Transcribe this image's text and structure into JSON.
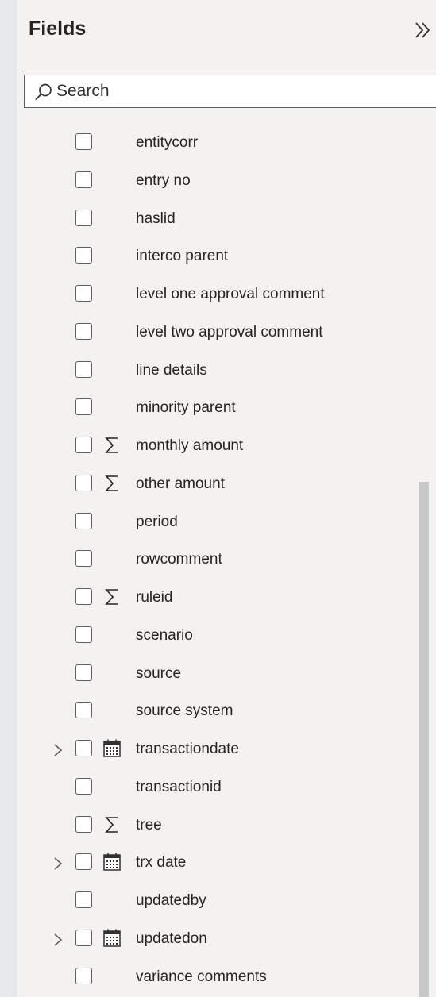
{
  "header": {
    "title": "Fields",
    "collapse_icon": "double-chevron-right-icon"
  },
  "search": {
    "placeholder": "Search",
    "value": ""
  },
  "fields": [
    {
      "label": "entitycorr",
      "type": "text",
      "expandable": false
    },
    {
      "label": "entry no",
      "type": "text",
      "expandable": false
    },
    {
      "label": "haslid",
      "type": "text",
      "expandable": false
    },
    {
      "label": "interco parent",
      "type": "text",
      "expandable": false
    },
    {
      "label": "level one approval comment",
      "type": "text",
      "expandable": false
    },
    {
      "label": "level two approval comment",
      "type": "text",
      "expandable": false
    },
    {
      "label": "line details",
      "type": "text",
      "expandable": false
    },
    {
      "label": "minority parent",
      "type": "text",
      "expandable": false
    },
    {
      "label": "monthly amount",
      "type": "sum",
      "expandable": false
    },
    {
      "label": "other amount",
      "type": "sum",
      "expandable": false
    },
    {
      "label": "period",
      "type": "text",
      "expandable": false
    },
    {
      "label": "rowcomment",
      "type": "text",
      "expandable": false
    },
    {
      "label": "ruleid",
      "type": "sum",
      "expandable": false
    },
    {
      "label": "scenario",
      "type": "text",
      "expandable": false
    },
    {
      "label": "source",
      "type": "text",
      "expandable": false
    },
    {
      "label": "source system",
      "type": "text",
      "expandable": false
    },
    {
      "label": "transactiondate",
      "type": "date",
      "expandable": true
    },
    {
      "label": "transactionid",
      "type": "text",
      "expandable": false
    },
    {
      "label": "tree",
      "type": "sum",
      "expandable": false
    },
    {
      "label": "trx date",
      "type": "date",
      "expandable": true
    },
    {
      "label": "updatedby",
      "type": "text",
      "expandable": false
    },
    {
      "label": "updatedon",
      "type": "date",
      "expandable": true
    },
    {
      "label": "variance comments",
      "type": "text",
      "expandable": false
    }
  ]
}
